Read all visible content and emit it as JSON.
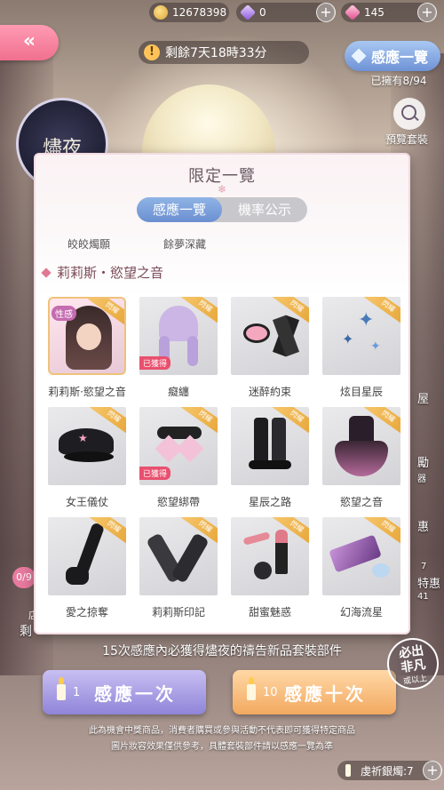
{
  "resources": {
    "gold": "12678398",
    "purple_gem": "0",
    "pink_gem": "145"
  },
  "timer_text": "剩餘7天18時33分",
  "induce_button": "感應一覽",
  "owned_text": "已擁有8/94",
  "preview_label": "預覽套裝",
  "seal_text": "燼夜",
  "side_right": [
    "屋",
    "勵",
    "惠",
    "特惠"
  ],
  "side_right_badges": [
    "器",
    "7",
    "41"
  ],
  "left_badge": "0/9",
  "left_small": "店",
  "left_text": "剩",
  "modal": {
    "title": "限定一覽",
    "tabs": {
      "active": "感應一覽",
      "inactive": "機率公示"
    },
    "subtabs": [
      "皎皎燭願",
      "餘夢深藏"
    ],
    "section": "莉莉斯・慾望之音",
    "ribbon_text": "閃耀",
    "obtained_label": "已獲得",
    "xg_label": "性感",
    "items": [
      {
        "name": "莉莉斯·慾望之音",
        "icon": "portrait-card",
        "obtained": false,
        "star": true
      },
      {
        "name": "癡纏",
        "icon": "hairstyle-lavender",
        "obtained": true,
        "star": false
      },
      {
        "name": "迷醉約束",
        "icon": "cuffs-accessory",
        "obtained": false,
        "star": false
      },
      {
        "name": "炫目星辰",
        "icon": "star-earrings",
        "obtained": false,
        "star": false
      },
      {
        "name": "女王儀仗",
        "icon": "police-cap",
        "obtained": false,
        "star": false
      },
      {
        "name": "慾望綁帶",
        "icon": "bow-collar",
        "obtained": true,
        "star": false
      },
      {
        "name": "星辰之路",
        "icon": "black-boots",
        "obtained": false,
        "star": false
      },
      {
        "name": "慾望之音",
        "icon": "black-dress",
        "obtained": false,
        "star": false
      },
      {
        "name": "愛之掠奪",
        "icon": "long-glove",
        "obtained": false,
        "star": false
      },
      {
        "name": "莉莉斯印記",
        "icon": "stockings",
        "obtained": false,
        "star": false
      },
      {
        "name": "甜蜜魅惑",
        "icon": "lipstick-makeup",
        "obtained": false,
        "star": false
      },
      {
        "name": "幻海流星",
        "icon": "handbag",
        "obtained": false,
        "star": false
      }
    ]
  },
  "footer_text": "15次感應內必獲得燼夜的禱告新品套裝部件",
  "buttons": {
    "once": {
      "count": "1",
      "label": "感應一次"
    },
    "ten": {
      "count": "10",
      "label": "感應十次"
    }
  },
  "stamp": {
    "line1": "必出",
    "line2": "非凡",
    "line3": "或以上"
  },
  "disclaimer": [
    "此為機會中獎商品，消費者購買或參與活動不代表即可獲得特定商品",
    "圖片妝容效果僅供參考，具體套裝部件請以感應一覽為準"
  ],
  "candle_count": "虔祈銀燭:7",
  "colors": {
    "accent_pink": "#f0708f",
    "accent_blue": "#6b8fd0",
    "gold": "#e6a537",
    "obtained_red": "#e8506e"
  }
}
